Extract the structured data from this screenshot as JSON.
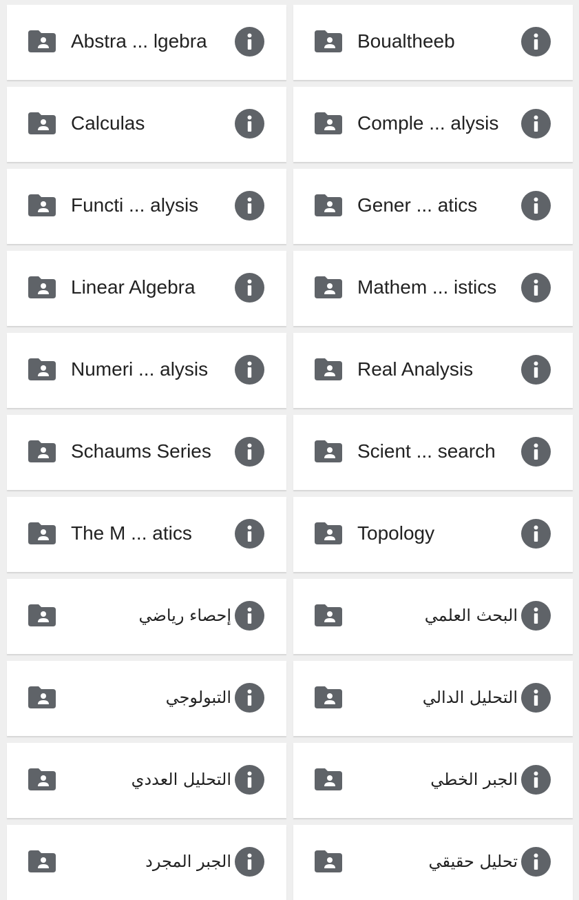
{
  "colors": {
    "background": "#efefef",
    "card": "#ffffff",
    "icon": "#5f6368",
    "text": "#222222"
  },
  "icons": {
    "folder": "shared-folder-icon",
    "info": "info-icon"
  },
  "folders": [
    {
      "name": "Abstra ... lgebra",
      "rtl": false
    },
    {
      "name": "Boualtheeb",
      "rtl": false
    },
    {
      "name": "Calculas",
      "rtl": false
    },
    {
      "name": "Comple ... alysis",
      "rtl": false
    },
    {
      "name": "Functi ... alysis",
      "rtl": false
    },
    {
      "name": "Gener ... atics",
      "rtl": false
    },
    {
      "name": "Linear Algebra",
      "rtl": false
    },
    {
      "name": "Mathem ... istics",
      "rtl": false
    },
    {
      "name": "Numeri ... alysis",
      "rtl": false
    },
    {
      "name": "Real Analysis",
      "rtl": false
    },
    {
      "name": "Schaums Series",
      "rtl": false
    },
    {
      "name": "Scient ... search",
      "rtl": false
    },
    {
      "name": "The M ... atics",
      "rtl": false
    },
    {
      "name": "Topology",
      "rtl": false
    },
    {
      "name": "إحصاء رياضي",
      "rtl": true
    },
    {
      "name": "البحث العلمي",
      "rtl": true
    },
    {
      "name": "التبولوجي",
      "rtl": true
    },
    {
      "name": "التحليل الدالي",
      "rtl": true
    },
    {
      "name": "التحليل العددي",
      "rtl": true
    },
    {
      "name": "الجبر الخطي",
      "rtl": true
    },
    {
      "name": "الجبر المجرد",
      "rtl": true
    },
    {
      "name": "تحليل حقيقي",
      "rtl": true
    }
  ]
}
